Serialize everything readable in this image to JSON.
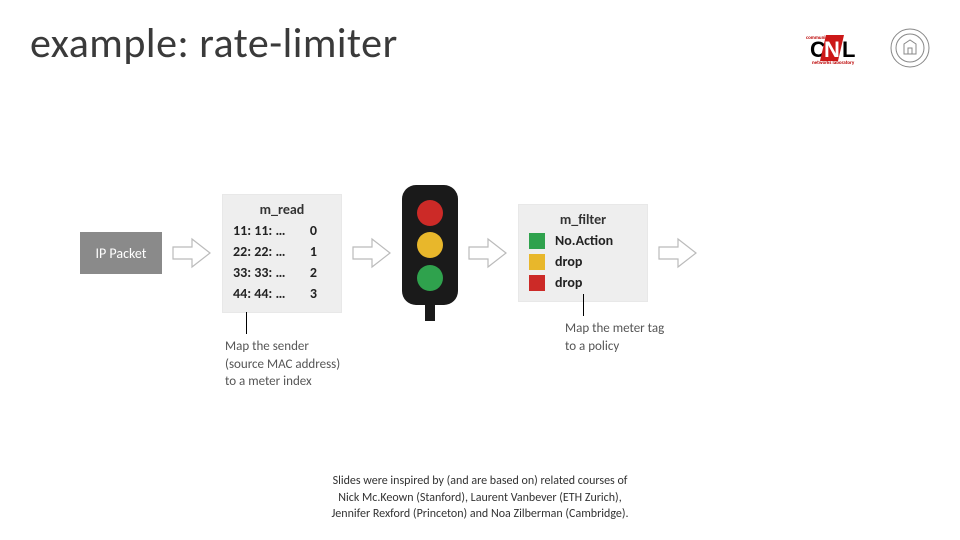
{
  "title": "example: rate-limiter",
  "ip_packet_label": "IP Packet",
  "m_read": {
    "header": "m_read",
    "rows": [
      {
        "mac": "11: 11: …",
        "idx": "0"
      },
      {
        "mac": "22: 22: …",
        "idx": "1"
      },
      {
        "mac": "33: 33: …",
        "idx": "2"
      },
      {
        "mac": "44: 44: …",
        "idx": "3"
      }
    ],
    "caption_l1": "Map the sender",
    "caption_l2": "(source MAC address)",
    "caption_l3": "to a meter index"
  },
  "m_filter": {
    "header": "m_filter",
    "rows": [
      {
        "color": "sw-grn",
        "action": "No.Action"
      },
      {
        "color": "sw-yel",
        "action": "drop"
      },
      {
        "color": "sw-red",
        "action": "drop"
      }
    ],
    "caption_l1": "Map the meter tag",
    "caption_l2": "to a policy"
  },
  "footer": {
    "l1": "Slides were inspired by (and are based on) related courses of",
    "l2": "Nick Mc.Keown (Stanford), Laurent Vanbever (ETH Zurich),",
    "l3": "Jennifer Rexford (Princeton) and Noa Zilberman (Cambridge)."
  }
}
